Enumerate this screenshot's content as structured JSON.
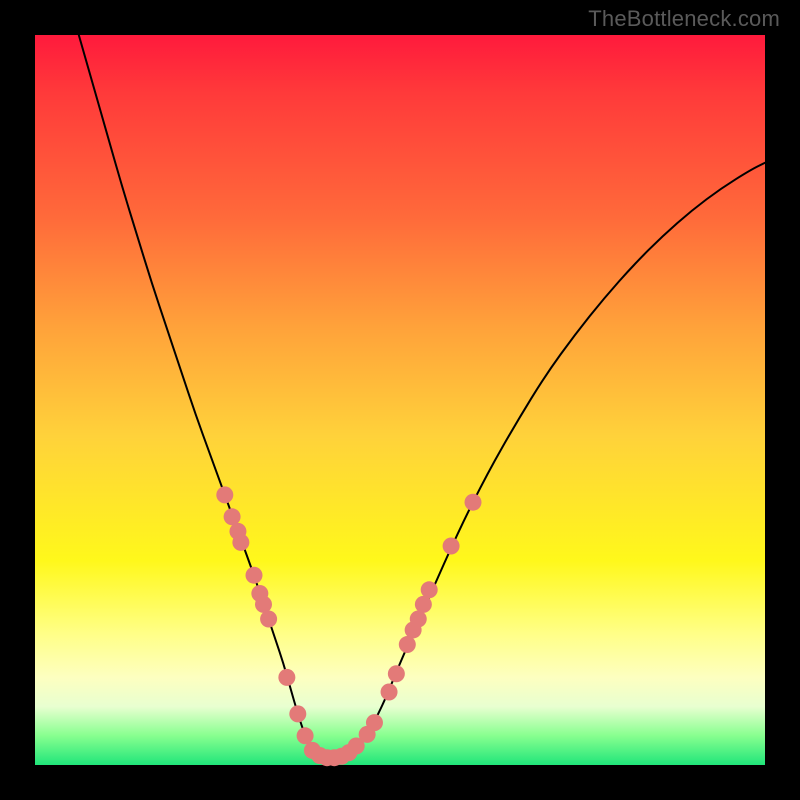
{
  "watermark": "TheBottleneck.com",
  "colors": {
    "background": "#000000",
    "curve_stroke": "#000000",
    "marker_fill": "#e37a78",
    "marker_stroke": "#d86b69"
  },
  "chart_data": {
    "type": "line",
    "title": "",
    "xlabel": "",
    "ylabel": "",
    "xlim": [
      0,
      100
    ],
    "ylim": [
      0,
      100
    ],
    "curve": {
      "x": [
        6,
        8,
        10,
        12,
        14,
        16,
        18,
        20,
        22,
        24,
        26,
        28,
        30,
        32,
        33,
        34,
        35,
        36,
        37,
        38,
        40,
        42,
        44,
        46,
        48,
        50,
        54,
        58,
        62,
        66,
        70,
        74,
        78,
        82,
        86,
        90,
        94,
        98,
        100
      ],
      "y": [
        100,
        93,
        86,
        79,
        72.5,
        66,
        60,
        54,
        48,
        42.5,
        37,
        31.5,
        26,
        20,
        17,
        14,
        10.5,
        7,
        4,
        2,
        1,
        1,
        2.5,
        5,
        9,
        14,
        23,
        32,
        40,
        47,
        53.5,
        59,
        64,
        68.5,
        72.5,
        76,
        79,
        81.5,
        82.5
      ]
    },
    "markers": [
      {
        "x": 26.0,
        "y": 37.0
      },
      {
        "x": 27.0,
        "y": 34.0
      },
      {
        "x": 27.8,
        "y": 32.0
      },
      {
        "x": 28.2,
        "y": 30.5
      },
      {
        "x": 30.0,
        "y": 26.0
      },
      {
        "x": 30.8,
        "y": 23.5
      },
      {
        "x": 31.3,
        "y": 22.0
      },
      {
        "x": 32.0,
        "y": 20.0
      },
      {
        "x": 34.5,
        "y": 12.0
      },
      {
        "x": 36.0,
        "y": 7.0
      },
      {
        "x": 37.0,
        "y": 4.0
      },
      {
        "x": 38.0,
        "y": 2.0
      },
      {
        "x": 39.0,
        "y": 1.3
      },
      {
        "x": 40.0,
        "y": 1.0
      },
      {
        "x": 41.0,
        "y": 1.0
      },
      {
        "x": 42.0,
        "y": 1.2
      },
      {
        "x": 43.0,
        "y": 1.7
      },
      {
        "x": 44.0,
        "y": 2.6
      },
      {
        "x": 45.5,
        "y": 4.2
      },
      {
        "x": 46.5,
        "y": 5.8
      },
      {
        "x": 48.5,
        "y": 10.0
      },
      {
        "x": 49.5,
        "y": 12.5
      },
      {
        "x": 51.0,
        "y": 16.5
      },
      {
        "x": 51.8,
        "y": 18.5
      },
      {
        "x": 52.5,
        "y": 20.0
      },
      {
        "x": 53.2,
        "y": 22.0
      },
      {
        "x": 54.0,
        "y": 24.0
      },
      {
        "x": 57.0,
        "y": 30.0
      },
      {
        "x": 60.0,
        "y": 36.0
      }
    ]
  }
}
